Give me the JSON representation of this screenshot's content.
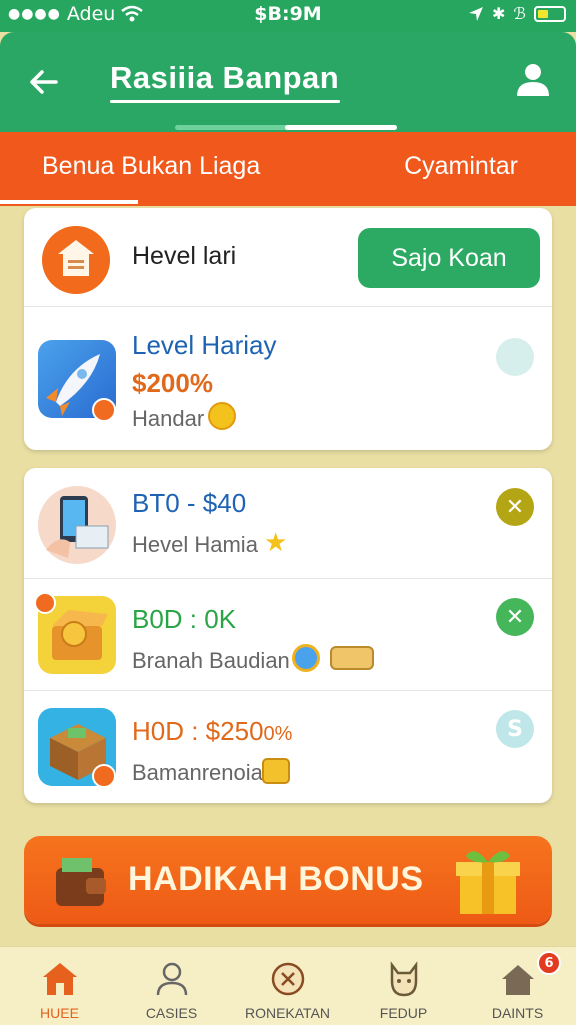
{
  "status_bar": {
    "carrier": "Adeu",
    "time": "$B:9M"
  },
  "app_bar": {
    "title": "Rasiiia Banpan"
  },
  "tabs": [
    {
      "label": "Benua Bukan Liaga"
    },
    {
      "label": "Cyamintar"
    }
  ],
  "level_card": {
    "label": "Hevel lari",
    "action_label": "Sajo Koan",
    "item": {
      "title": "Level Hariay",
      "value": "$200%",
      "subtitle": "Handar"
    }
  },
  "list": [
    {
      "title": "BT0 - $40",
      "subtitle": "Hevel Hamia",
      "title_color": "#1e63b3",
      "status_color": "#b4a514",
      "status_icon": "close-icon"
    },
    {
      "title": "B0D : 0K",
      "subtitle": "Branah Baudian",
      "title_color": "#2aa447",
      "status_color": "#45b75a",
      "status_icon": "close-icon"
    },
    {
      "title": "H0D : $250",
      "title_suffix": "0%",
      "subtitle": "Bamanrenoia",
      "title_color": "#e1691c",
      "status_color": "#bfe6e8",
      "status_icon": "s-icon",
      "status_text": "S"
    }
  ],
  "bonus_banner": {
    "label": "HADIKAH BONUS"
  },
  "bottom_nav": [
    {
      "label": "HUEE",
      "icon": "home-icon",
      "active": true
    },
    {
      "label": "CASIES",
      "icon": "person-icon"
    },
    {
      "label": "RONEKATAN",
      "icon": "compass-icon"
    },
    {
      "label": "FEDUP",
      "icon": "dog-icon"
    },
    {
      "label": "DAINTS",
      "icon": "house-icon",
      "badge": "6"
    }
  ],
  "colors": {
    "primary_green": "#2aa765",
    "accent_orange": "#f0581c",
    "background": "#e9dfa3"
  }
}
